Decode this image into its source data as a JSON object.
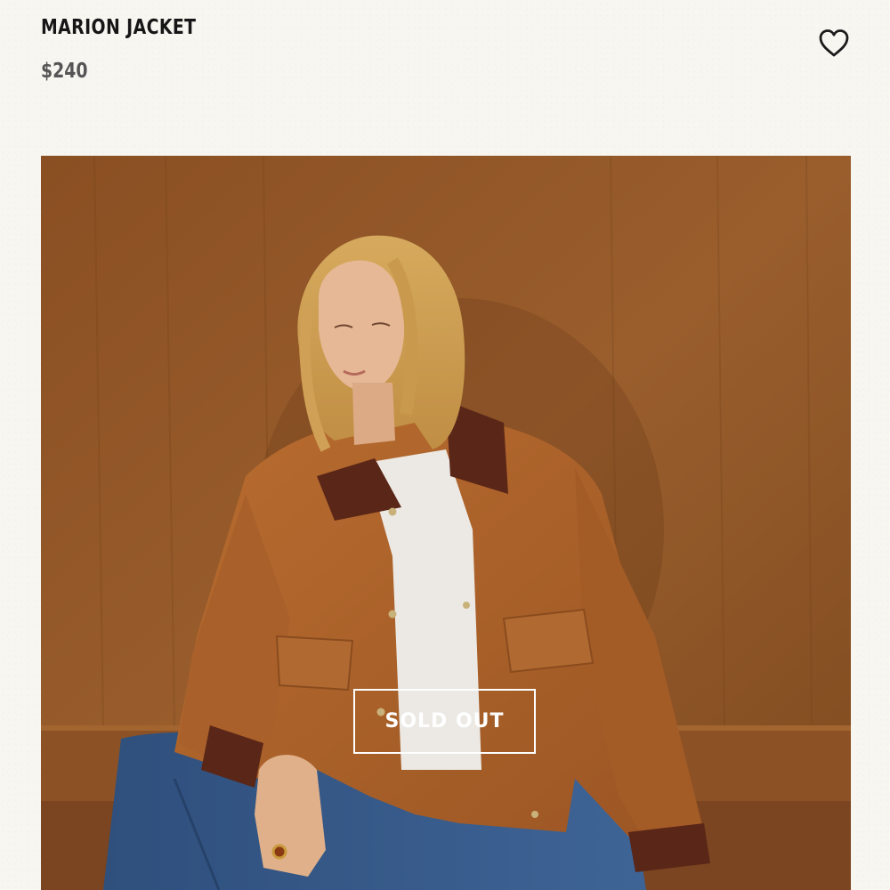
{
  "product": {
    "title": "MARION JACKET",
    "price": "$240",
    "status_badge": "SOLD OUT"
  },
  "icons": {
    "wishlist": "heart-outline-icon"
  },
  "colors": {
    "page_background": "#f8f6f1",
    "title_text": "#161616",
    "price_text": "#555555",
    "badge_border": "#ffffff"
  },
  "image": {
    "alt": ""
  }
}
